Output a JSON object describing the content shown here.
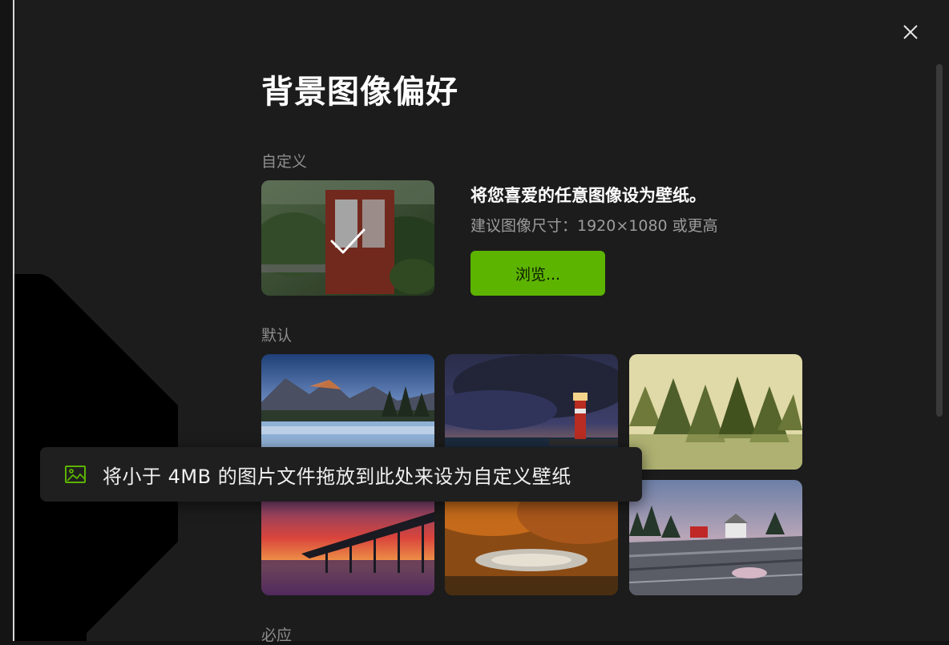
{
  "page": {
    "title": "背景图像偏好"
  },
  "sections": {
    "custom_label": "自定义",
    "default_label": "默认",
    "next_label": "必应"
  },
  "custom": {
    "heading": "将您喜爱的任意图像设为壁纸。",
    "hint": "建议图像尺寸：1920×1080 或更高",
    "browse_label": "浏览...",
    "selected": true
  },
  "toast": {
    "message": "将小于 4MB 的图片文件拖放到此处来设为自定义壁纸",
    "icon": "image-icon"
  },
  "default_wallpapers": [
    {
      "name": "mountain-lake"
    },
    {
      "name": "lighthouse"
    },
    {
      "name": "misty-forest"
    },
    {
      "name": "pier-sunset"
    },
    {
      "name": "autumn-pond"
    },
    {
      "name": "rocky-coast"
    }
  ],
  "colors": {
    "accent": "#5cb300",
    "background": "#1c1c1c",
    "toast_bg": "#1f1f1f"
  }
}
